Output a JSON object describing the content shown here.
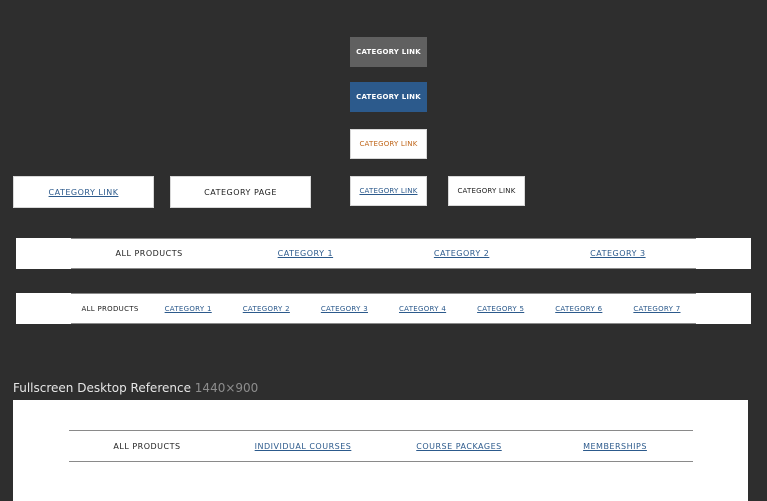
{
  "buttons": {
    "gray": "CATEGORY LINK",
    "blue": "CATEGORY LINK",
    "white_orange": "CATEGORY LINK",
    "white_blue": "CATEGORY LINK",
    "white_black": "CATEGORY LINK"
  },
  "large_items": {
    "link": "CATEGORY LINK",
    "page": "CATEGORY PAGE"
  },
  "nav_four": [
    "ALL PRODUCTS",
    "CATEGORY 1",
    "CATEGORY 2",
    "CATEGORY 3"
  ],
  "nav_eight": [
    "ALL PRODUCTS",
    "CATEGORY 1",
    "CATEGORY 2",
    "CATEGORY 3",
    "CATEGORY 4",
    "CATEGORY 5",
    "CATEGORY 6",
    "CATEGORY 7"
  ],
  "reference": {
    "title": "Fullscreen Desktop Reference",
    "dimensions": "1440×900",
    "nav": [
      "ALL PRODUCTS",
      "INDIVIDUAL COURSES",
      "COURSE PACKAGES",
      "MEMBERSHIPS"
    ]
  },
  "colors": {
    "background": "#2e2e2e",
    "link_blue": "#2c5a8c",
    "orange": "#c0661a",
    "gray_button": "#606060"
  }
}
